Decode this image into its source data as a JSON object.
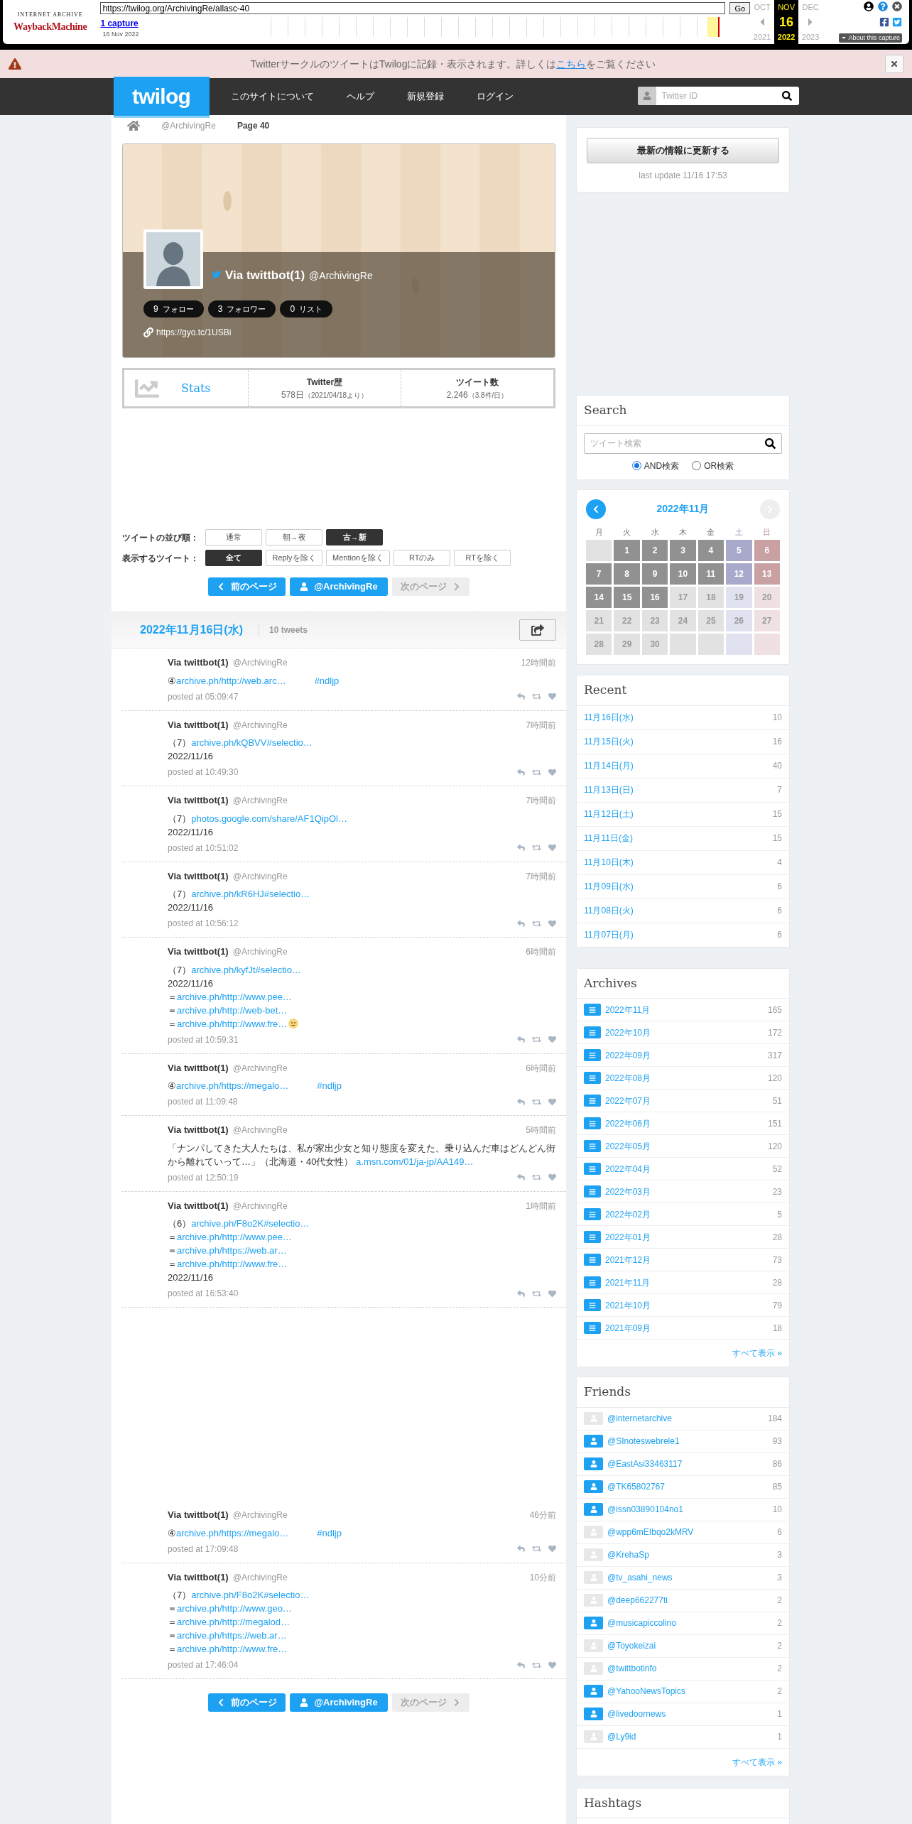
{
  "wayback": {
    "logo_top": "INTERNET ARCHIVE",
    "logo": "WaybackMachine",
    "url": "https://twilog.org/ArchivingRe/allasc-40",
    "go": "Go",
    "captures": "1 capture",
    "capture_date": "16 Nov 2022",
    "months": [
      {
        "month": "OCT",
        "year": "2021",
        "selected": false
      },
      {
        "month": "NOV",
        "day": "16",
        "year": "2022",
        "selected": true
      },
      {
        "month": "DEC",
        "year": "2023",
        "selected": false
      }
    ],
    "about": "About this capture"
  },
  "notice": {
    "text": "TwitterサークルのツイートはTwilogに記録・表示されます。詳しくは",
    "link": "こちら",
    "after": "をご覧ください"
  },
  "header": {
    "logo": "twilog",
    "nav": [
      "このサイトについて",
      "ヘルプ",
      "新規登録",
      "ログイン"
    ],
    "search_placeholder": "Twitter ID"
  },
  "breadcrumb": [
    "@ArchivingRe",
    "Page 40"
  ],
  "profile": {
    "name": "Via twittbot(1)",
    "handle": "@ArchivingRe",
    "counts": [
      {
        "count": "9",
        "label": "フォロー"
      },
      {
        "count": "3",
        "label": "フォロワー"
      },
      {
        "count": "0",
        "label": "リスト"
      }
    ],
    "url": "https://gyo.tc/1USBi"
  },
  "stats": {
    "title": "Stats",
    "columns": [
      {
        "label": "Twitter歴",
        "value": "578日",
        "note": "（2021/04/18より）"
      },
      {
        "label": "ツイート数",
        "value": "2,246",
        "note": "（3.8件/日）"
      }
    ]
  },
  "filters": [
    {
      "label": "ツイートの並び順：",
      "options": [
        {
          "label": "通常",
          "selected": false
        },
        {
          "label": "朝→夜",
          "selected": false
        },
        {
          "label": "古→新",
          "selected": true
        }
      ]
    },
    {
      "label": "表示するツイート：",
      "options": [
        {
          "label": "全て",
          "selected": true
        },
        {
          "label": "Replyを除く",
          "selected": false
        },
        {
          "label": "Mentionを除く",
          "selected": false
        },
        {
          "label": "RTのみ",
          "selected": false
        },
        {
          "label": "RTを除く",
          "selected": false
        }
      ]
    }
  ],
  "pagination_top": [
    {
      "kind": "prev",
      "label": "前のページ",
      "disabled": false
    },
    {
      "kind": "user",
      "label": "@ArchivingRe",
      "disabled": false
    },
    {
      "kind": "next",
      "label": "次のページ",
      "disabled": true
    }
  ],
  "day": {
    "date": "2022年11月16日(水)",
    "count": "10 tweets"
  },
  "tweet_groups": [
    [
      {
        "name": "Via twittbot(1)",
        "handle": "@ArchivingRe",
        "ago": "12時間前",
        "posted": "posted at 05:09:47",
        "lines": [
          [
            {
              "kind": "text",
              "text": "④"
            },
            {
              "kind": "link",
              "text": "archive.ph/http://web.arc…"
            },
            {
              "kind": "hashtag",
              "text": "#ndljp"
            }
          ]
        ]
      },
      {
        "name": "Via twittbot(1)",
        "handle": "@ArchivingRe",
        "ago": "7時間前",
        "posted": "posted at 10:49:30",
        "lines": [
          [
            {
              "kind": "text",
              "text": "（7）"
            },
            {
              "kind": "link",
              "text": "archive.ph/kQBVV#selectio…"
            }
          ],
          [
            {
              "kind": "text",
              "text": "2022/11/16"
            }
          ]
        ]
      },
      {
        "name": "Via twittbot(1)",
        "handle": "@ArchivingRe",
        "ago": "7時間前",
        "posted": "posted at 10:51:02",
        "lines": [
          [
            {
              "kind": "text",
              "text": "（7）"
            },
            {
              "kind": "link",
              "text": "photos.google.com/share/AF1QipOl…"
            }
          ],
          [
            {
              "kind": "text",
              "text": "2022/11/16"
            }
          ]
        ]
      },
      {
        "name": "Via twittbot(1)",
        "handle": "@ArchivingRe",
        "ago": "7時間前",
        "posted": "posted at 10:56:12",
        "lines": [
          [
            {
              "kind": "text",
              "text": "（7）"
            },
            {
              "kind": "link",
              "text": "archive.ph/kR6HJ#selectio…"
            }
          ],
          [
            {
              "kind": "text",
              "text": "2022/11/16"
            }
          ]
        ]
      },
      {
        "name": "Via twittbot(1)",
        "handle": "@ArchivingRe",
        "ago": "6時間前",
        "posted": "posted at 10:59:31",
        "lines": [
          [
            {
              "kind": "text",
              "text": "（7）"
            },
            {
              "kind": "link",
              "text": "archive.ph/kyfJt#selectio…"
            }
          ],
          [
            {
              "kind": "text",
              "text": "2022/11/16"
            }
          ],
          [
            {
              "kind": "text",
              "text": "＝"
            },
            {
              "kind": "link",
              "text": "archive.ph/http://www.pee…"
            }
          ],
          [
            {
              "kind": "text",
              "text": "＝"
            },
            {
              "kind": "link",
              "text": "archive.ph/http://web-bet…"
            }
          ],
          [
            {
              "kind": "text",
              "text": "＝"
            },
            {
              "kind": "link",
              "text": "archive.ph/http://www.fre…"
            },
            {
              "kind": "emoji"
            }
          ]
        ]
      },
      {
        "name": "Via twittbot(1)",
        "handle": "@ArchivingRe",
        "ago": "6時間前",
        "posted": "posted at 11:09:48",
        "lines": [
          [
            {
              "kind": "text",
              "text": "④"
            },
            {
              "kind": "link",
              "text": "archive.ph/https://megalo…"
            },
            {
              "kind": "hashtag",
              "text": "#ndljp"
            }
          ]
        ]
      },
      {
        "name": "Via twittbot(1)",
        "handle": "@ArchivingRe",
        "ago": "5時間前",
        "posted": "posted at 12:50:19",
        "lines": [
          [
            {
              "kind": "text",
              "text": "「ナンパしてきた大人たちは、私が家出少女と知り態度を変えた。乗り込んだ車はどんどん街から離れていって…」（北海道・40代女性） "
            },
            {
              "kind": "link",
              "text": "a.msn.com/01/ja-jp/AA149…"
            }
          ]
        ]
      },
      {
        "name": "Via twittbot(1)",
        "handle": "@ArchivingRe",
        "ago": "1時間前",
        "posted": "posted at 16:53:40",
        "lines": [
          [
            {
              "kind": "text",
              "text": "（6）"
            },
            {
              "kind": "link",
              "text": "archive.ph/F8o2K#selectio…"
            }
          ],
          [
            {
              "kind": "text",
              "text": "＝"
            },
            {
              "kind": "link",
              "text": "archive.ph/http://www.pee…"
            }
          ],
          [
            {
              "kind": "text",
              "text": "＝"
            },
            {
              "kind": "link",
              "text": "archive.ph/https://web.ar…"
            }
          ],
          [
            {
              "kind": "text",
              "text": "＝"
            },
            {
              "kind": "link",
              "text": "archive.ph/http://www.fre…"
            }
          ],
          [
            {
              "kind": "text",
              "text": "2022/11/16"
            }
          ]
        ]
      }
    ],
    [
      {
        "name": "Via twittbot(1)",
        "handle": "@ArchivingRe",
        "ago": "46分前",
        "posted": "posted at 17:09:48",
        "lines": [
          [
            {
              "kind": "text",
              "text": "④"
            },
            {
              "kind": "link",
              "text": "archive.ph/https://megalo…"
            },
            {
              "kind": "hashtag",
              "text": "#ndljp"
            }
          ]
        ]
      },
      {
        "name": "Via twittbot(1)",
        "handle": "@ArchivingRe",
        "ago": "10分前",
        "posted": "posted at 17:46:04",
        "lines": [
          [
            {
              "kind": "text",
              "text": "（7）"
            },
            {
              "kind": "link",
              "text": "archive.ph/F8o2K#selectio…"
            }
          ],
          [
            {
              "kind": "text",
              "text": "＝"
            },
            {
              "kind": "link",
              "text": "archive.ph/http://www.geo…"
            }
          ],
          [
            {
              "kind": "text",
              "text": "＝"
            },
            {
              "kind": "link",
              "text": "archive.ph/http://megalod…"
            }
          ],
          [
            {
              "kind": "text",
              "text": "＝"
            },
            {
              "kind": "link",
              "text": "archive.ph/https://web.ar…"
            }
          ],
          [
            {
              "kind": "text",
              "text": "＝"
            },
            {
              "kind": "link",
              "text": "archive.ph/http://www.fre…"
            }
          ]
        ]
      }
    ]
  ],
  "pagination_bottom": [
    {
      "kind": "prev",
      "label": "前のページ",
      "disabled": false
    },
    {
      "kind": "user",
      "label": "@ArchivingRe",
      "disabled": false
    },
    {
      "kind": "next",
      "label": "次のページ",
      "disabled": true
    }
  ],
  "update": {
    "button": "最新の情報に更新する",
    "last": "last update 11/16 17:53"
  },
  "search": {
    "title": "Search",
    "placeholder": "ツイート検索",
    "modes": [
      {
        "label": "AND検索",
        "selected": true
      },
      {
        "label": "OR検索",
        "selected": false
      }
    ]
  },
  "calendar": {
    "title": "2022年11月",
    "prev_disabled": false,
    "next_disabled": true,
    "weekdays": [
      "月",
      "火",
      "水",
      "木",
      "金",
      "土",
      "日"
    ],
    "weeks": [
      [
        {
          "kind": "blank"
        },
        {
          "kind": "day",
          "day": "1",
          "active": true
        },
        {
          "kind": "day",
          "day": "2",
          "active": true
        },
        {
          "kind": "day",
          "day": "3",
          "active": true
        },
        {
          "kind": "day",
          "day": "4",
          "active": true
        },
        {
          "kind": "day",
          "day": "5",
          "active": true
        },
        {
          "kind": "day",
          "day": "6",
          "active": true
        }
      ],
      [
        {
          "kind": "day",
          "day": "7",
          "active": true
        },
        {
          "kind": "day",
          "day": "8",
          "active": true
        },
        {
          "kind": "day",
          "day": "9",
          "active": true
        },
        {
          "kind": "day",
          "day": "10",
          "active": true
        },
        {
          "kind": "day",
          "day": "11",
          "active": true
        },
        {
          "kind": "day",
          "day": "12",
          "active": true
        },
        {
          "kind": "day",
          "day": "13",
          "active": true
        }
      ],
      [
        {
          "kind": "day",
          "day": "14",
          "active": true
        },
        {
          "kind": "day",
          "day": "15",
          "active": true
        },
        {
          "kind": "day",
          "day": "16",
          "active": true
        },
        {
          "kind": "day",
          "day": "17",
          "active": false
        },
        {
          "kind": "day",
          "day": "18",
          "active": false
        },
        {
          "kind": "day",
          "day": "19",
          "active": false
        },
        {
          "kind": "day",
          "day": "20",
          "active": false
        }
      ],
      [
        {
          "kind": "day",
          "day": "21",
          "active": false
        },
        {
          "kind": "day",
          "day": "22",
          "active": false
        },
        {
          "kind": "day",
          "day": "23",
          "active": false
        },
        {
          "kind": "day",
          "day": "24",
          "active": false
        },
        {
          "kind": "day",
          "day": "25",
          "active": false
        },
        {
          "kind": "day",
          "day": "26",
          "active": false
        },
        {
          "kind": "day",
          "day": "27",
          "active": false
        }
      ],
      [
        {
          "kind": "day",
          "day": "28",
          "active": false
        },
        {
          "kind": "day",
          "day": "29",
          "active": false
        },
        {
          "kind": "day",
          "day": "30",
          "active": false
        },
        {
          "kind": "blank"
        },
        {
          "kind": "blank"
        },
        {
          "kind": "blank"
        },
        {
          "kind": "blank"
        }
      ]
    ]
  },
  "recent": {
    "title": "Recent",
    "items": [
      {
        "label": "11月16日(水)",
        "count": "10"
      },
      {
        "label": "11月15日(火)",
        "count": "16"
      },
      {
        "label": "11月14日(月)",
        "count": "40"
      },
      {
        "label": "11月13日(日)",
        "count": "7"
      },
      {
        "label": "11月12日(土)",
        "count": "15"
      },
      {
        "label": "11月11日(金)",
        "count": "15"
      },
      {
        "label": "11月10日(木)",
        "count": "4"
      },
      {
        "label": "11月09日(水)",
        "count": "6"
      },
      {
        "label": "11月08日(火)",
        "count": "6"
      },
      {
        "label": "11月07日(月)",
        "count": "6"
      }
    ]
  },
  "archives": {
    "title": "Archives",
    "items": [
      {
        "label": "2022年11月",
        "count": "165"
      },
      {
        "label": "2022年10月",
        "count": "172"
      },
      {
        "label": "2022年09月",
        "count": "317"
      },
      {
        "label": "2022年08月",
        "count": "120"
      },
      {
        "label": "2022年07月",
        "count": "51"
      },
      {
        "label": "2022年06月",
        "count": "151"
      },
      {
        "label": "2022年05月",
        "count": "120"
      },
      {
        "label": "2022年04月",
        "count": "52"
      },
      {
        "label": "2022年03月",
        "count": "23"
      },
      {
        "label": "2022年02月",
        "count": "5"
      },
      {
        "label": "2022年01月",
        "count": "28"
      },
      {
        "label": "2021年12月",
        "count": "73"
      },
      {
        "label": "2021年11月",
        "count": "28"
      },
      {
        "label": "2021年10月",
        "count": "79"
      },
      {
        "label": "2021年09月",
        "count": "18"
      }
    ],
    "more": "すべて表示 »"
  },
  "friends": {
    "title": "Friends",
    "items": [
      {
        "handle": "@internetarchive",
        "count": "184",
        "color": "#e8e8e8"
      },
      {
        "handle": "@SInoteswebrele1",
        "count": "93",
        "color": "#1da1f2"
      },
      {
        "handle": "@EastAsi33463117",
        "count": "86",
        "color": "#1da1f2"
      },
      {
        "handle": "@TK65802767",
        "count": "85",
        "color": "#1da1f2"
      },
      {
        "handle": "@issn03890104no1",
        "count": "10",
        "color": "#1da1f2"
      },
      {
        "handle": "@wpp6mEIbqo2kMRV",
        "count": "6",
        "color": "#e8e8e8"
      },
      {
        "handle": "@KrehaSp",
        "count": "3",
        "color": "#e8e8e8"
      },
      {
        "handle": "@tv_asahi_news",
        "count": "3",
        "color": "#e8e8e8"
      },
      {
        "handle": "@deep662277ti",
        "count": "2",
        "color": "#e8e8e8"
      },
      {
        "handle": "@musicapiccolino",
        "count": "2",
        "color": "#1da1f2"
      },
      {
        "handle": "@Toyokeizai",
        "count": "2",
        "color": "#e8e8e8"
      },
      {
        "handle": "@twittbotinfo",
        "count": "2",
        "color": "#e8e8e8"
      },
      {
        "handle": "@YahooNewsTopics",
        "count": "2",
        "color": "#1da1f2"
      },
      {
        "handle": "@livedoornews",
        "count": "1",
        "color": "#1da1f2"
      },
      {
        "handle": "@Ly9id",
        "count": "1",
        "color": "#e8e8e8"
      }
    ],
    "more": "すべて表示 »"
  },
  "hashtags": {
    "title": "Hashtags"
  }
}
